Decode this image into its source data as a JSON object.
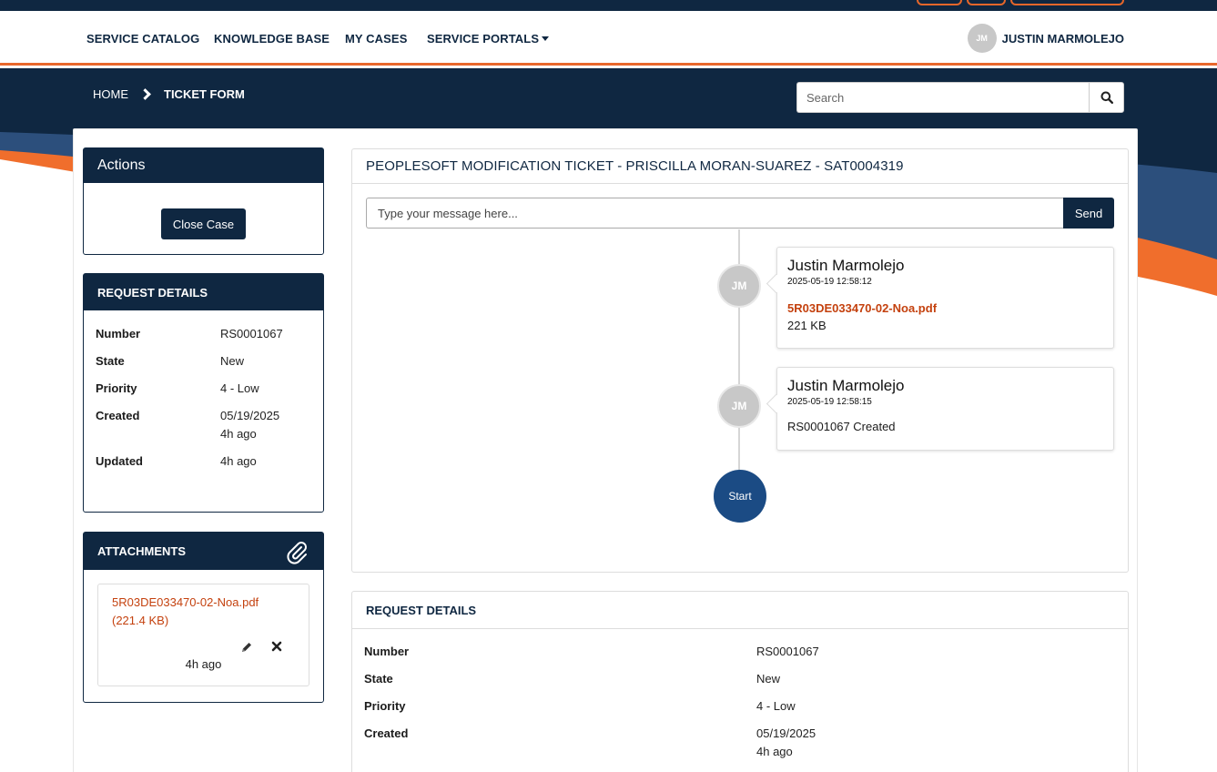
{
  "navbar": {
    "items": [
      {
        "label": "SERVICE CATALOG"
      },
      {
        "label": "KNOWLEDGE BASE"
      },
      {
        "label": "MY CASES"
      },
      {
        "label": "SERVICE PORTALS"
      }
    ],
    "user": {
      "initials": "JM",
      "name": "JUSTIN MARMOLEJO"
    }
  },
  "breadcrumb": {
    "home": "HOME",
    "current": "TICKET FORM"
  },
  "search": {
    "placeholder": "Search"
  },
  "actions": {
    "title": "Actions",
    "close_case_label": "Close Case"
  },
  "request_details_side": {
    "title": "REQUEST DETAILS",
    "rows": [
      {
        "key": "Number",
        "value": "RS0001067",
        "sub": ""
      },
      {
        "key": "State",
        "value": "New",
        "sub": ""
      },
      {
        "key": "Priority",
        "value": "4 - Low",
        "sub": ""
      },
      {
        "key": "Created",
        "value": "05/19/2025",
        "sub": "4h ago"
      },
      {
        "key": "Updated",
        "value": "4h ago",
        "sub": ""
      }
    ]
  },
  "attachments": {
    "title": "ATTACHMENTS",
    "file_label": "5R03DE033470-02-Noa.pdf (221.4 KB)",
    "time": "4h ago"
  },
  "ticket": {
    "title": "PEOPLESOFT MODIFICATION TICKET - PRISCILLA MORAN-SUAREZ - SAT0004319",
    "message_placeholder": "Type your message here...",
    "send_label": "Send",
    "entries": [
      {
        "initials": "JM",
        "author": "Justin Marmolejo",
        "time": "2025-05-19 12:58:12",
        "file": "5R03DE033470-02-Noa.pdf",
        "size": "221 KB"
      },
      {
        "initials": "JM",
        "author": "Justin Marmolejo",
        "time": "2025-05-19 12:58:15",
        "text": "RS0001067 Created"
      }
    ],
    "start_label": "Start"
  },
  "request_details_main": {
    "title": "REQUEST DETAILS",
    "rows": [
      {
        "key": "Number",
        "value": "RS0001067",
        "sub": ""
      },
      {
        "key": "State",
        "value": "New",
        "sub": ""
      },
      {
        "key": "Priority",
        "value": "4 - Low",
        "sub": ""
      },
      {
        "key": "Created",
        "value": "05/19/2025",
        "sub": "4h ago"
      }
    ]
  },
  "colors": {
    "navy": "#0f2741",
    "accent_orange": "#e9682c",
    "link_orange": "#c4410e",
    "start_blue": "#1b4b84"
  }
}
